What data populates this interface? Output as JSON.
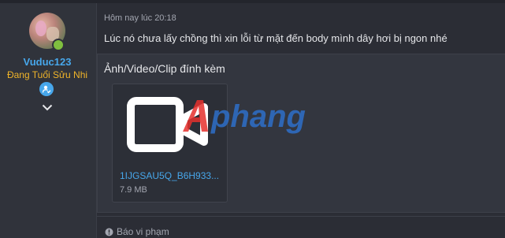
{
  "user": {
    "name": "Vuduc123",
    "title": "Đang Tuổi Sửu Nhi"
  },
  "post": {
    "timestamp": "Hôm nay lúc 20:18",
    "text": "Lúc nó chưa lấy chồng thì xin lỗi từ mặt đến body mình dây hơi bị ngon nhé"
  },
  "attachments": {
    "heading": "Ảnh/Video/Clip đính kèm",
    "file": {
      "name": "1IJGSAU5Q_B6H933...",
      "size": "7.9 MB"
    },
    "watermark": "phang"
  },
  "footer": {
    "report_label": "Báo vi phạm"
  },
  "colors": {
    "accent": "#47a7eb",
    "title": "#f0b429",
    "online": "#7fbf3f",
    "watermark_red": "#e5302d",
    "watermark_blue": "#2e6fc9"
  },
  "icons": {
    "verified": "user-check-icon",
    "expand": "chevron-down-icon",
    "video": "video-file-icon",
    "report": "alert-circle-icon"
  }
}
